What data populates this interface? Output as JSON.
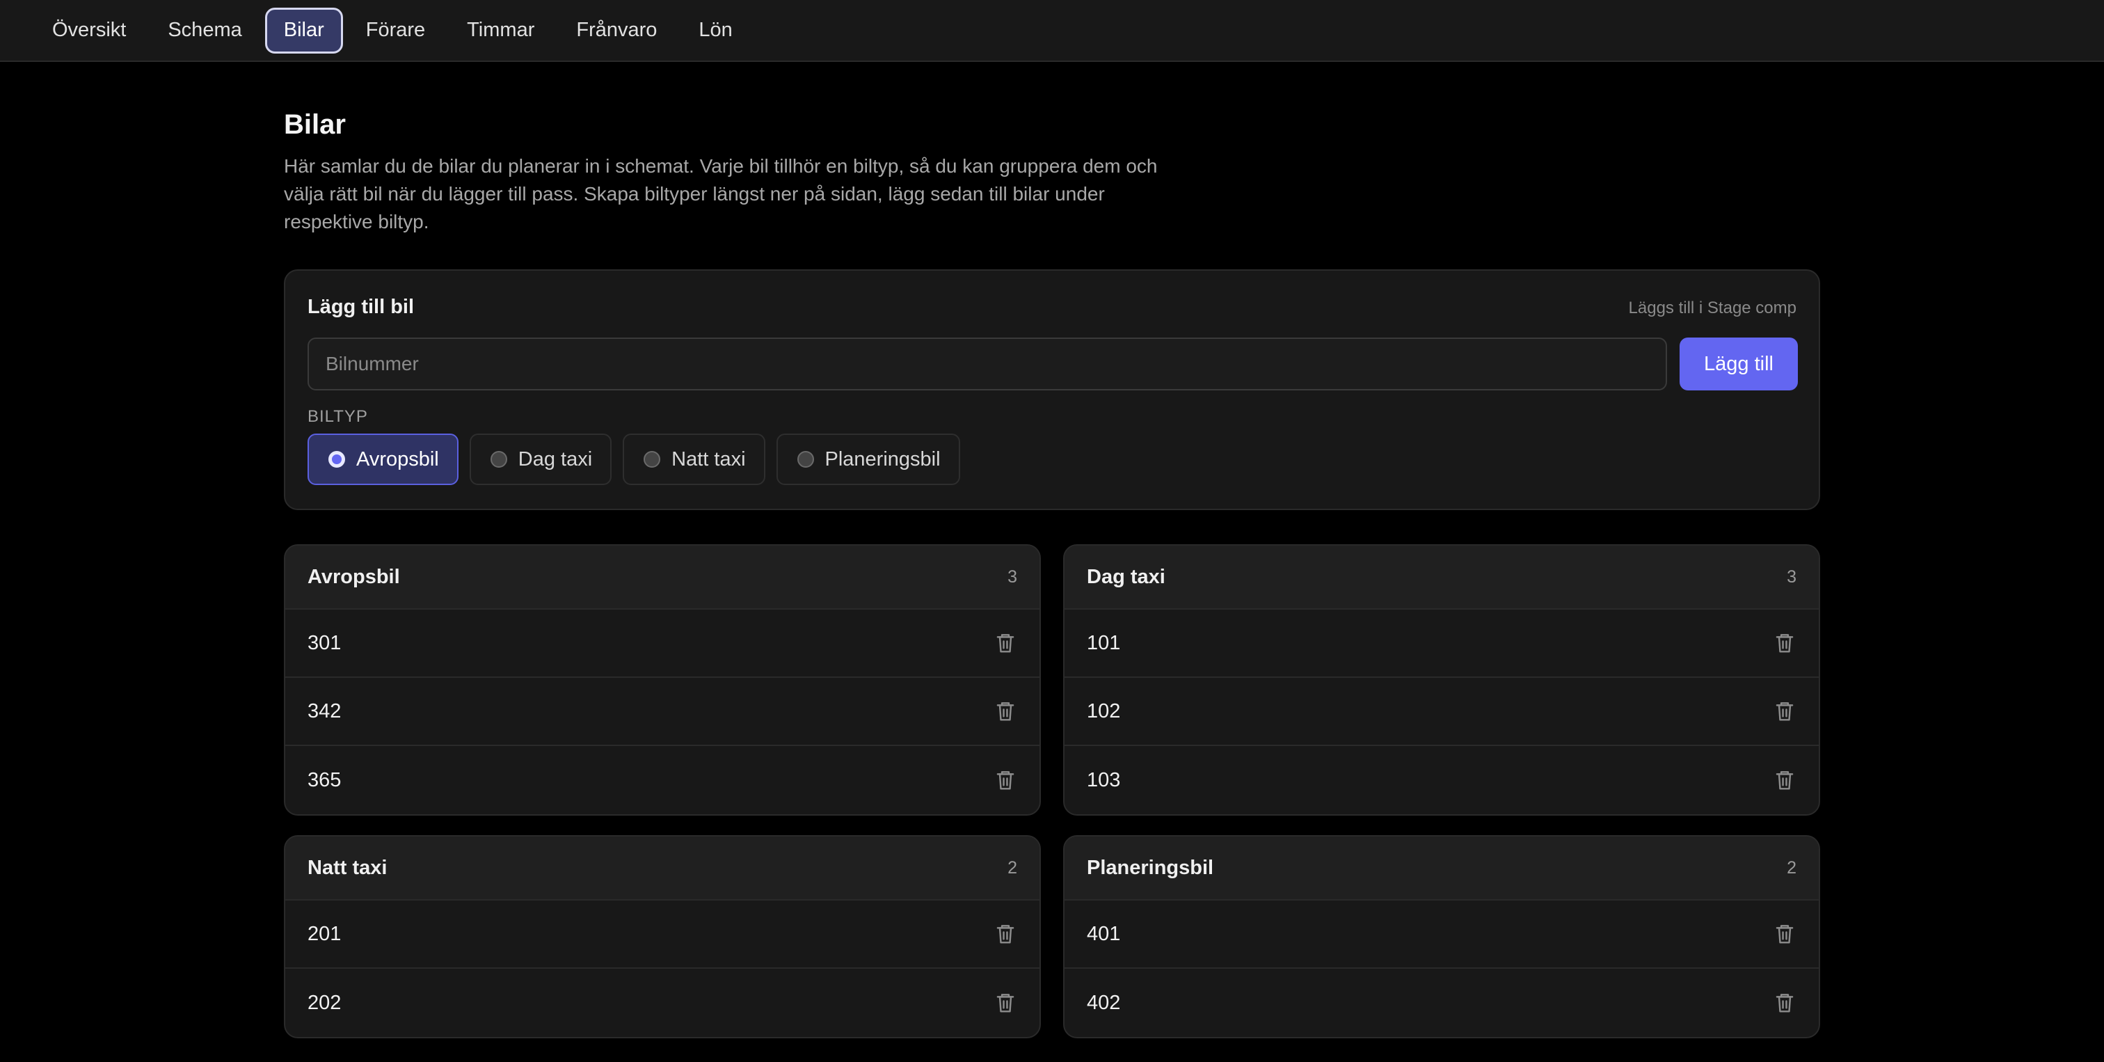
{
  "nav": {
    "items": [
      {
        "label": "Översikt",
        "active": false
      },
      {
        "label": "Schema",
        "active": false
      },
      {
        "label": "Bilar",
        "active": true
      },
      {
        "label": "Förare",
        "active": false
      },
      {
        "label": "Timmar",
        "active": false
      },
      {
        "label": "Frånvaro",
        "active": false
      },
      {
        "label": "Lön",
        "active": false
      }
    ]
  },
  "page": {
    "title": "Bilar",
    "description": "Här samlar du de bilar du planerar in i schemat. Varje bil tillhör en biltyp, så du kan gruppera dem och välja rätt bil när du lägger till pass. Skapa biltyper längst ner på sidan, lägg sedan till bilar under respektive biltyp."
  },
  "add_car": {
    "title": "Lägg till bil",
    "note": "Läggs till i Stage comp",
    "input_value": "",
    "input_placeholder": "Bilnummer",
    "button_label": "Lägg till",
    "biltyp_label": "BILTYP",
    "options": [
      {
        "label": "Avropsbil",
        "selected": true
      },
      {
        "label": "Dag taxi",
        "selected": false
      },
      {
        "label": "Natt taxi",
        "selected": false
      },
      {
        "label": "Planeringsbil",
        "selected": false
      }
    ]
  },
  "groups": [
    {
      "name": "Avropsbil",
      "count": "3",
      "cars": [
        "301",
        "342",
        "365"
      ]
    },
    {
      "name": "Dag taxi",
      "count": "3",
      "cars": [
        "101",
        "102",
        "103"
      ]
    },
    {
      "name": "Natt taxi",
      "count": "2",
      "cars": [
        "201",
        "202"
      ]
    },
    {
      "name": "Planeringsbil",
      "count": "2",
      "cars": [
        "401",
        "402"
      ]
    }
  ],
  "icons": {
    "delete": "trash-icon",
    "radio": "radio-dot-icon"
  },
  "colors": {
    "accent": "#6366f1",
    "active_nav_bg": "#353a66",
    "background": "#000000",
    "card": "#181818"
  }
}
